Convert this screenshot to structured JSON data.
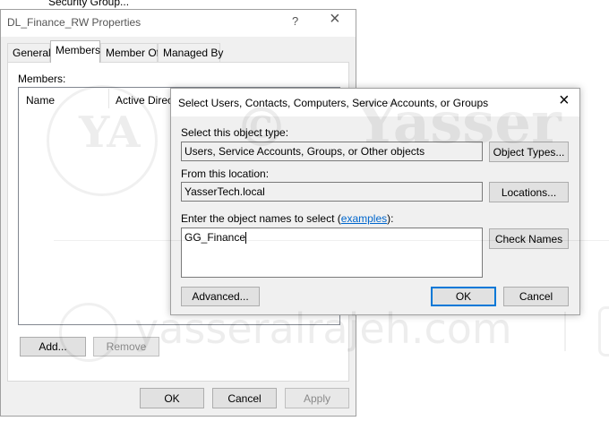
{
  "background_window": {
    "partial_title": "Security Group..."
  },
  "properties": {
    "title": "DL_Finance_RW Properties",
    "help_icon": "?",
    "close_icon": "×",
    "tabs": [
      {
        "label": "General"
      },
      {
        "label": "Members"
      },
      {
        "label": "Member Of"
      },
      {
        "label": "Managed By"
      }
    ],
    "members_label": "Members:",
    "columns": [
      "Name",
      "Active Directory"
    ],
    "add_button": "Add...",
    "remove_button": "Remove",
    "ok_button": "OK",
    "cancel_button": "Cancel",
    "apply_button": "Apply"
  },
  "select_dialog": {
    "title": "Select Users, Contacts, Computers, Service Accounts, or Groups",
    "close_icon": "×",
    "object_type_label": "Select this object type:",
    "object_type_value": "Users, Service Accounts, Groups, or Other objects",
    "object_types_button": "Object Types...",
    "location_label": "From this location:",
    "location_value": "YasserTech.local",
    "locations_button": "Locations...",
    "enter_names_label_prefix": "Enter the object names to select (",
    "enter_names_link": "examples",
    "enter_names_label_suffix": "):",
    "names_value": "GG_Finance",
    "check_names_button": "Check Names",
    "advanced_button": "Advanced...",
    "ok_button": "OK",
    "cancel_button": "Cancel"
  },
  "watermark": {
    "logo_text": "YA",
    "copyright": "©",
    "brand": "Yasser",
    "site": "yasseralrajeh.com"
  },
  "colors": {
    "accent": "#0078d7",
    "link": "#0066cc",
    "button_face": "#e1e1e1",
    "window_bg": "#f0f0f0"
  }
}
